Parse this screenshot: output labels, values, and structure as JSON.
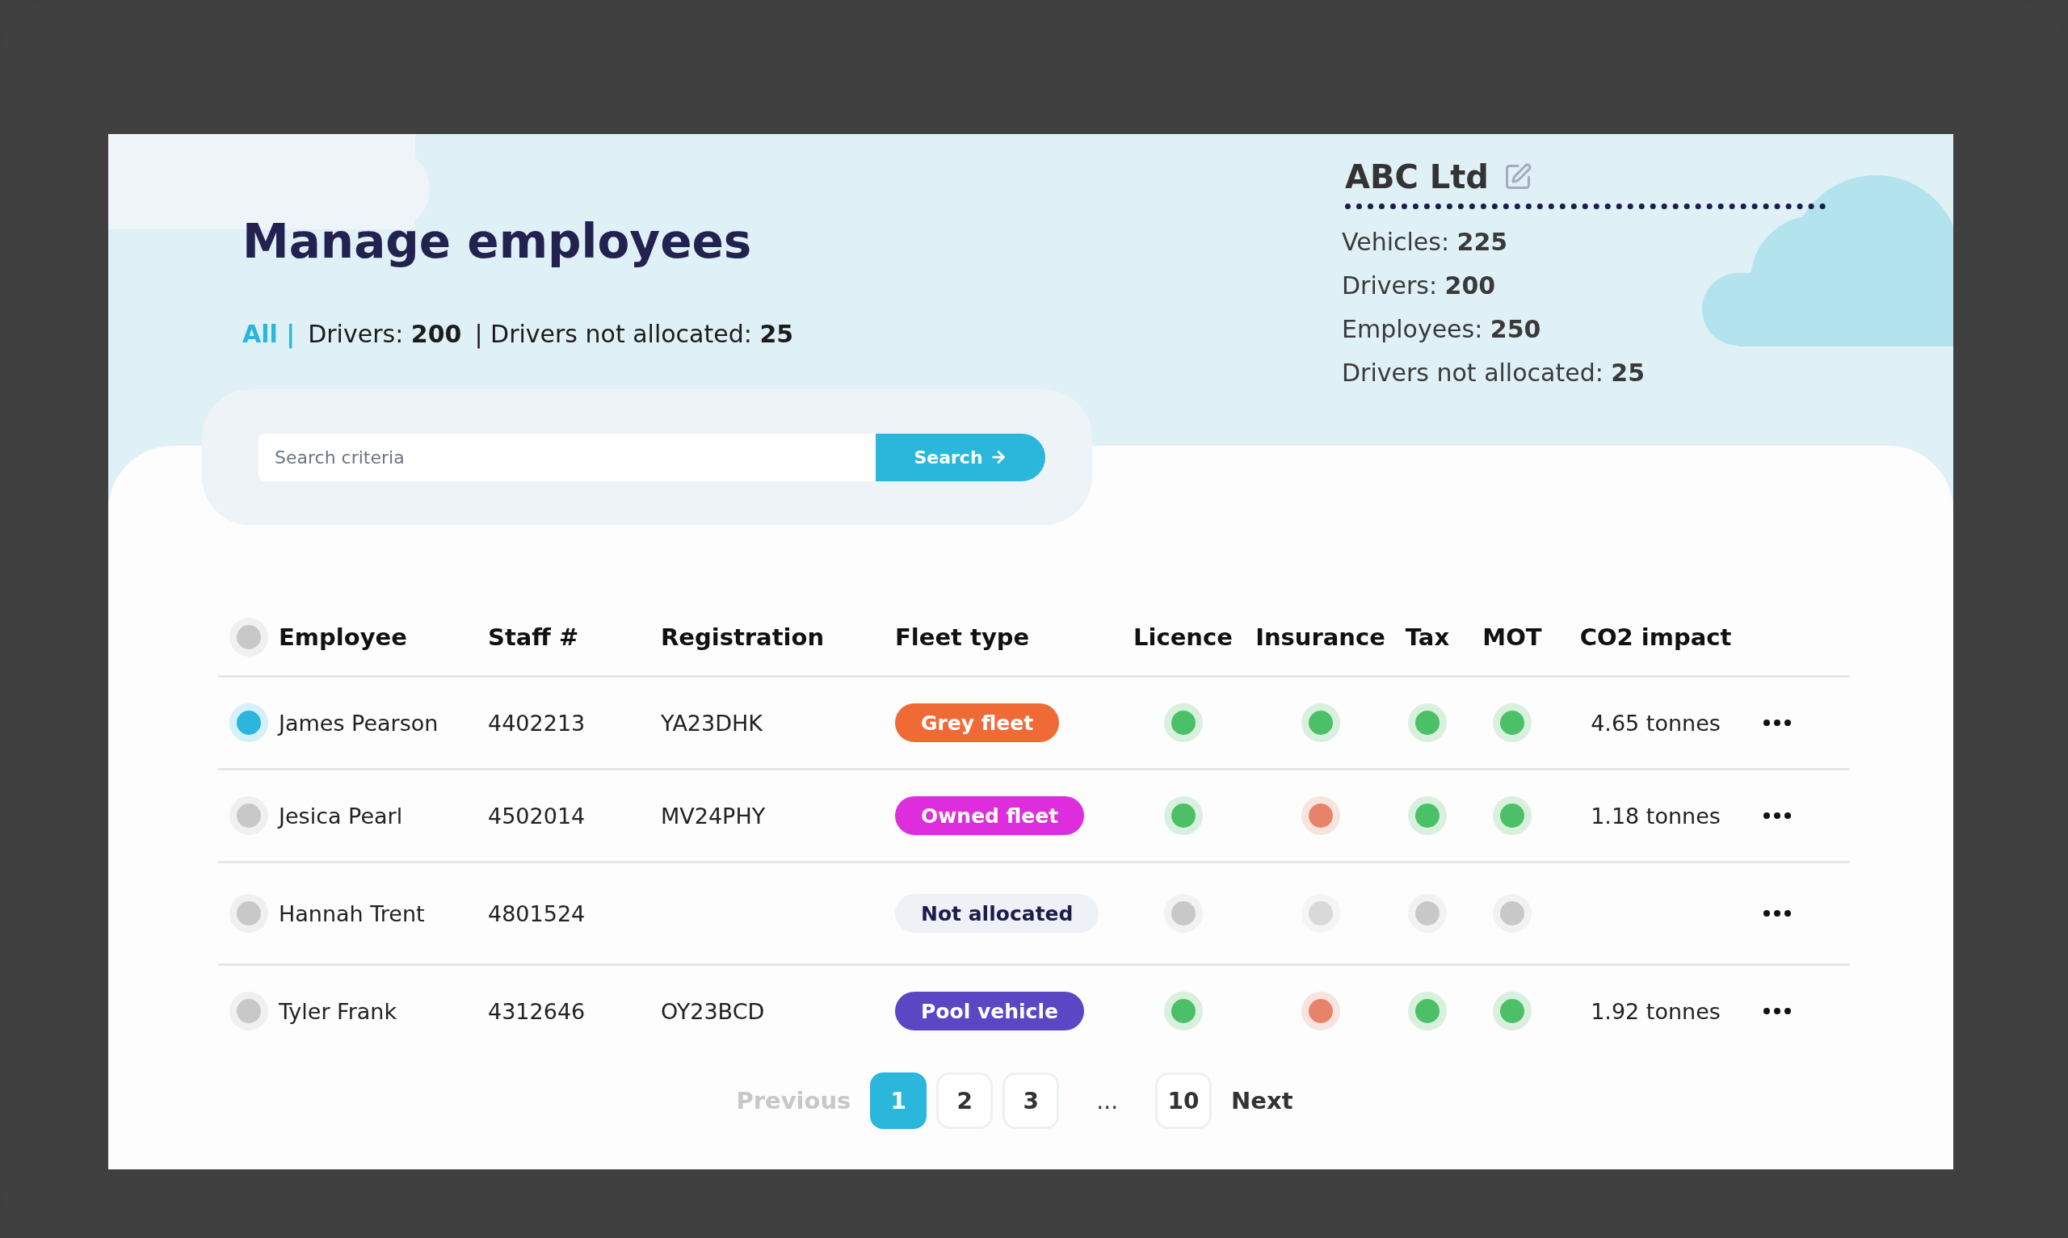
{
  "page": {
    "title": "Manage employees"
  },
  "filters": [
    {
      "label": "All |",
      "selected": true
    },
    {
      "label": "Drivers: **200**",
      "selected": false
    },
    {
      "label": "| Drivers not allocated: **25**",
      "selected": false
    }
  ],
  "company": {
    "name": "ABC Ltd",
    "stats": [
      "Vehicles: **225**",
      "Drivers: **200**",
      "Employees: **250**",
      "Drivers not allocated: **25**"
    ]
  },
  "search": {
    "placeholder": "Search criteria",
    "button": "Search"
  },
  "table": {
    "select_all": {
      "selected": false
    },
    "columns": [
      "Employee",
      "Staff #",
      "Registration",
      "Fleet type",
      "Licence",
      "Insurance",
      "Tax",
      "MOT",
      "CO2 impact"
    ],
    "rows": [
      {
        "selected": true,
        "employee": "James Pearson",
        "staff": "4402213",
        "registration": "YA23DHK",
        "fleet": {
          "label": "Grey fleet",
          "color": "#f06a35"
        },
        "statuses": [
          {
            "color": "#4cc066"
          },
          {
            "color": "#4cc066"
          },
          {
            "color": "#4cc066"
          },
          {
            "color": "#4cc066"
          }
        ],
        "co2": "4.65 tonnes"
      },
      {
        "selected": false,
        "employee": "Jesica Pearl",
        "staff": "4502014",
        "registration": "MV24PHY",
        "fleet": {
          "label": "Owned fleet",
          "color": "#dd2ddd"
        },
        "statuses": [
          {
            "color": "#4cc066"
          },
          {
            "color": "#e8836b"
          },
          {
            "color": "#4cc066"
          },
          {
            "color": "#4cc066"
          }
        ],
        "co2": "1.18 tonnes"
      },
      {
        "selected": false,
        "employee": "Hannah Trent",
        "staff": "4801524",
        "fleet": {
          "label": "Not allocated",
          "color": "#eef2f6"
        },
        "statuses": [
          {
            "color": "#c8c8c8"
          },
          {
            "color": "#d9d9d9"
          },
          {
            "color": "#c8c8c8"
          },
          {
            "color": "#c8c8c8"
          }
        ]
      },
      {
        "selected": false,
        "employee": "Tyler Frank",
        "staff": "4312646",
        "registration": "OY23BCD",
        "fleet": {
          "label": "Pool vehicle",
          "color": "#5b46c4"
        },
        "statuses": [
          {
            "color": "#4cc066"
          },
          {
            "color": "#e8836b"
          },
          {
            "color": "#4cc066"
          },
          {
            "color": "#4cc066"
          }
        ],
        "co2": "1.92 tonnes"
      }
    ]
  },
  "pagination": {
    "previous": {
      "label": "Previous",
      "disabled": true
    },
    "pages": [
      {
        "kind": "page",
        "label": "1",
        "selected": true
      },
      {
        "kind": "page",
        "label": "2",
        "selected": false
      },
      {
        "kind": "page",
        "label": "3",
        "selected": false
      },
      {
        "kind": "gap",
        "label": "..."
      },
      {
        "kind": "page",
        "label": "10",
        "selected": false
      }
    ],
    "next": {
      "label": "Next",
      "disabled": false
    }
  }
}
